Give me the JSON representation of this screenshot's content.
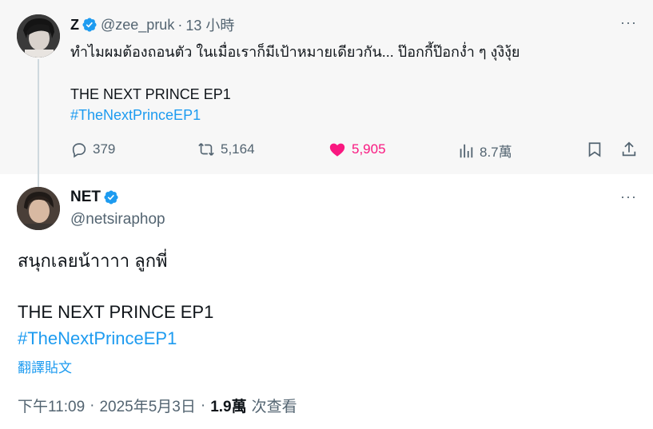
{
  "quoted": {
    "name": "Z",
    "handle": "@zee_pruk",
    "separator": "·",
    "time": "13 小時",
    "text": "ทำไมผมต้องถอนตัว ในเมื่อเราก็มีเป้าหมายเดียวกัน... ป๊อกกี้ป๊อกง่ำ ๆ งุงิงุ้ย",
    "title_line": "THE NEXT PRINCE EP1",
    "hashtag": "#TheNextPrinceEP1",
    "more": "···",
    "stats": {
      "replies": "379",
      "retweets": "5,164",
      "likes": "5,905",
      "views": "8.7萬"
    }
  },
  "main": {
    "name": "NET",
    "handle": "@netsiraphop",
    "more": "···",
    "text": "สนุกเลยน้าาาา ลูกพี่",
    "title_line": "THE NEXT PRINCE EP1",
    "hashtag": "#TheNextPrinceEP1",
    "translate": "翻譯貼文",
    "time": "下午11:09",
    "separator": "·",
    "date": "2025年5月3日",
    "views_count": "1.9萬",
    "views_label": "次查看"
  },
  "colors": {
    "accent": "#1d9bf0",
    "like": "#f91880",
    "muted": "#536471",
    "quoted_bg": "#f7f7f7"
  },
  "icons": [
    "verified-badge-icon",
    "reply-icon",
    "retweet-icon",
    "heart-icon",
    "views-icon",
    "bookmark-icon",
    "share-icon",
    "more-icon"
  ]
}
